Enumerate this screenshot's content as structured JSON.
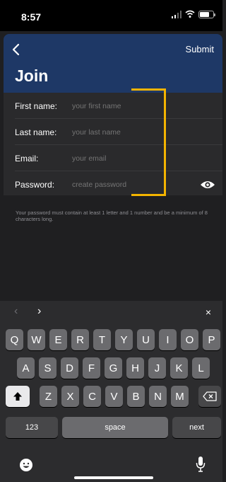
{
  "status": {
    "time": "8:57"
  },
  "header": {
    "submit_label": "Submit",
    "title": "Join"
  },
  "form": {
    "fields": [
      {
        "label": "First name:",
        "placeholder": "your first name"
      },
      {
        "label": "Last name:",
        "placeholder": "your last name"
      },
      {
        "label": "Email:",
        "placeholder": "your email"
      },
      {
        "label": "Password:",
        "placeholder": "create password"
      }
    ],
    "hint": "Your password must contain at least 1 letter and 1 number and be a minimum of 8 characters long."
  },
  "keyboard": {
    "nav_prev": "‹",
    "nav_next": "›",
    "close": "×",
    "row1": [
      "Q",
      "W",
      "E",
      "R",
      "T",
      "Y",
      "U",
      "I",
      "O",
      "P"
    ],
    "row2": [
      "A",
      "S",
      "D",
      "F",
      "G",
      "H",
      "J",
      "K",
      "L"
    ],
    "row3": [
      "Z",
      "X",
      "C",
      "V",
      "B",
      "N",
      "M"
    ],
    "numbers_label": "123",
    "space_label": "space",
    "next_label": "next"
  },
  "colors": {
    "header_bg": "#1e3866",
    "highlight": "#f4b400"
  }
}
